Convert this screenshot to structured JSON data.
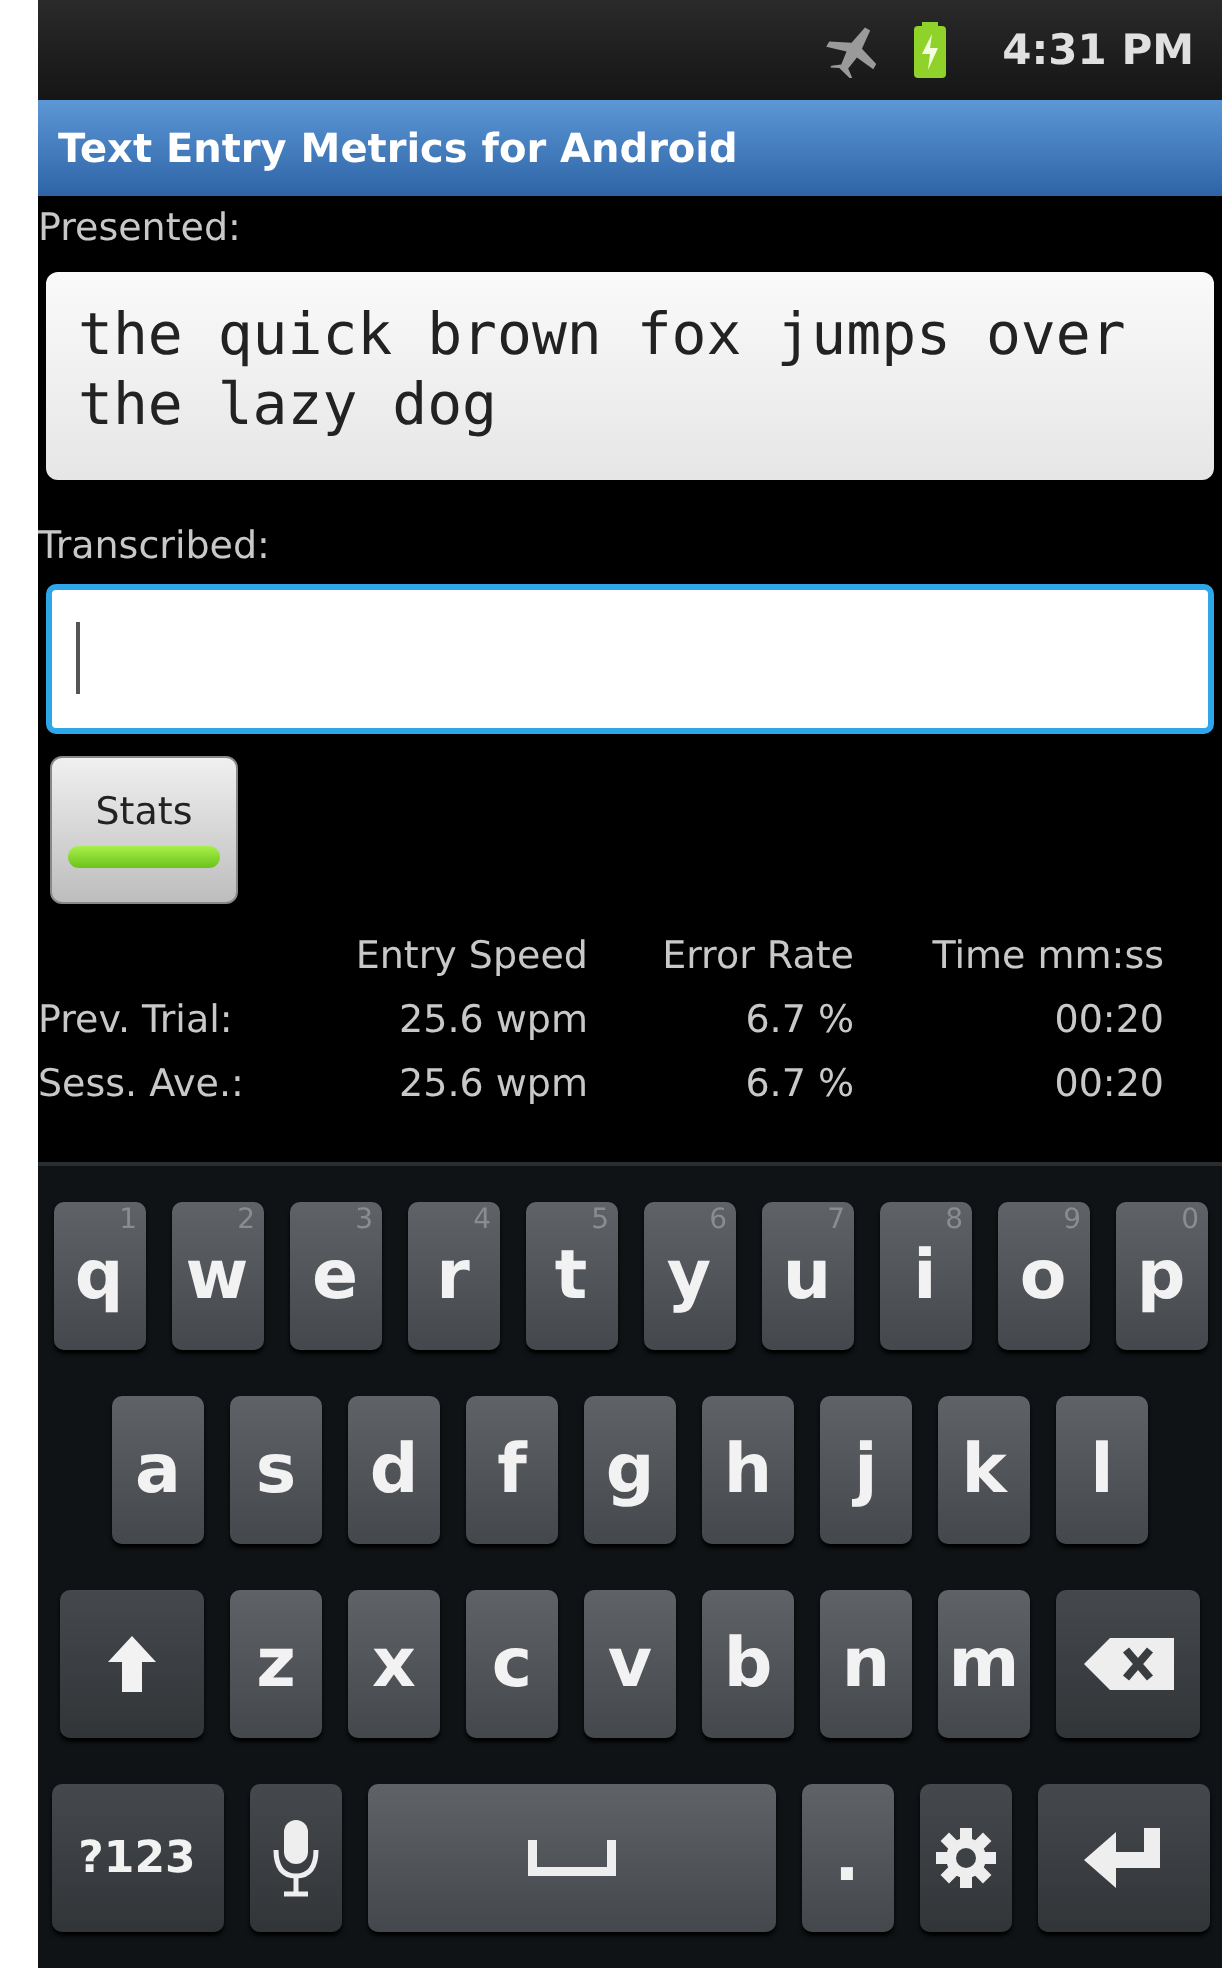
{
  "status_bar": {
    "time": "4:31 PM",
    "airplane_mode": true,
    "charging": true
  },
  "title_bar": {
    "title": "Text Entry Metrics for Android"
  },
  "presented": {
    "label": "Presented:",
    "text": "the quick brown fox jumps over the lazy dog"
  },
  "transcribed": {
    "label": "Transcribed:",
    "focused": true
  },
  "stats_button": {
    "label": "Stats",
    "on": true
  },
  "stats_table": {
    "columns": [
      "Entry Speed",
      "Error Rate",
      "Time mm:ss"
    ],
    "rows": [
      {
        "label": "Prev. Trial:",
        "cells": [
          "25.6 wpm",
          "6.7 %",
          "00:20"
        ]
      },
      {
        "label": "Sess. Ave.:",
        "cells": [
          "25.6 wpm",
          "6.7 %",
          "00:20"
        ]
      }
    ]
  },
  "keyboard": {
    "rows": [
      [
        {
          "kind": "letter",
          "label": "q",
          "hint": "1"
        },
        {
          "kind": "letter",
          "label": "w",
          "hint": "2"
        },
        {
          "kind": "letter",
          "label": "e",
          "hint": "3"
        },
        {
          "kind": "letter",
          "label": "r",
          "hint": "4"
        },
        {
          "kind": "letter",
          "label": "t",
          "hint": "5"
        },
        {
          "kind": "letter",
          "label": "y",
          "hint": "6"
        },
        {
          "kind": "letter",
          "label": "u",
          "hint": "7"
        },
        {
          "kind": "letter",
          "label": "i",
          "hint": "8"
        },
        {
          "kind": "letter",
          "label": "o",
          "hint": "9"
        },
        {
          "kind": "letter",
          "label": "p",
          "hint": "0"
        }
      ],
      [
        {
          "kind": "letter",
          "label": "a"
        },
        {
          "kind": "letter",
          "label": "s"
        },
        {
          "kind": "letter",
          "label": "d"
        },
        {
          "kind": "letter",
          "label": "f"
        },
        {
          "kind": "letter",
          "label": "g"
        },
        {
          "kind": "letter",
          "label": "h"
        },
        {
          "kind": "letter",
          "label": "j"
        },
        {
          "kind": "letter",
          "label": "k"
        },
        {
          "kind": "letter",
          "label": "l"
        }
      ],
      [
        {
          "kind": "shift"
        },
        {
          "kind": "letter",
          "label": "z"
        },
        {
          "kind": "letter",
          "label": "x"
        },
        {
          "kind": "letter",
          "label": "c"
        },
        {
          "kind": "letter",
          "label": "v"
        },
        {
          "kind": "letter",
          "label": "b"
        },
        {
          "kind": "letter",
          "label": "n"
        },
        {
          "kind": "letter",
          "label": "m"
        },
        {
          "kind": "backspace"
        }
      ],
      [
        {
          "kind": "symbols",
          "label": "?123"
        },
        {
          "kind": "mic"
        },
        {
          "kind": "space"
        },
        {
          "kind": "letter",
          "label": "."
        },
        {
          "kind": "settings"
        },
        {
          "kind": "enter"
        }
      ]
    ]
  }
}
